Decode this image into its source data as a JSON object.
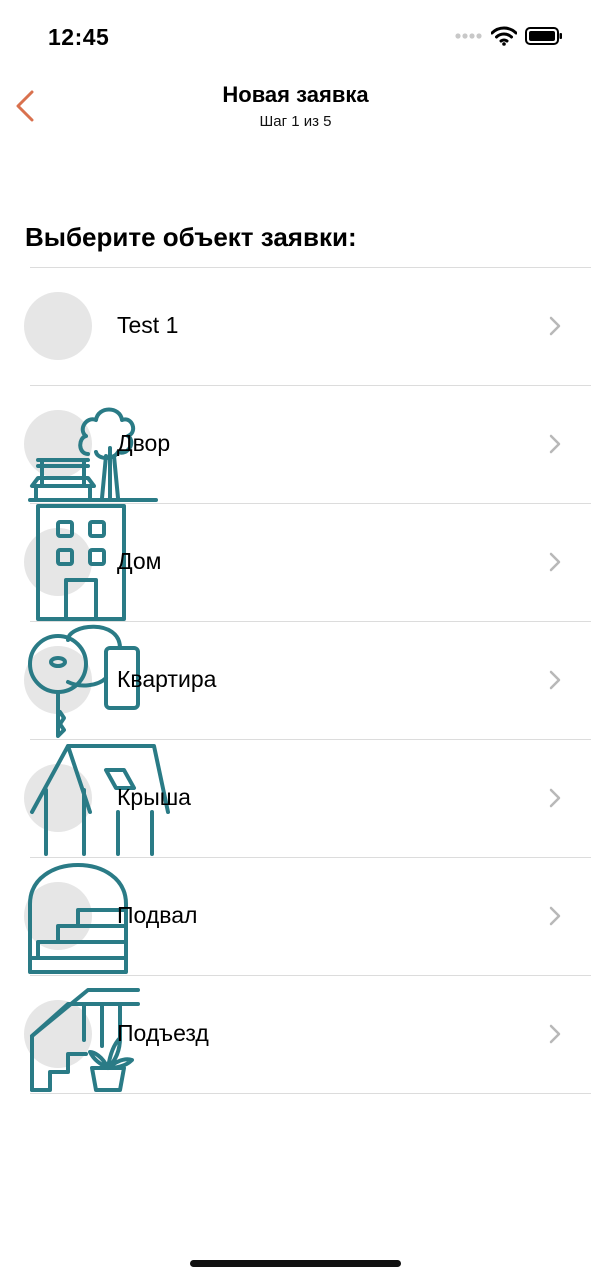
{
  "status_bar": {
    "time": "12:45"
  },
  "nav": {
    "title": "Новая заявка",
    "subtitle": "Шаг 1 из 5"
  },
  "section_title": "Выберите объект заявки:",
  "items": [
    {
      "label": "Test 1",
      "icon": "none"
    },
    {
      "label": "Двор",
      "icon": "yard-icon"
    },
    {
      "label": "Дом",
      "icon": "building-icon"
    },
    {
      "label": "Квартира",
      "icon": "apartment-key-icon"
    },
    {
      "label": "Крыша",
      "icon": "roof-icon"
    },
    {
      "label": "Подвал",
      "icon": "basement-icon"
    },
    {
      "label": "Подъезд",
      "icon": "entrance-icon"
    }
  ],
  "colors": {
    "accent": "#D9714E",
    "icon_teal": "#2A7B86",
    "placeholder": "#E6E6E6",
    "chevron": "#B8B8B8"
  }
}
